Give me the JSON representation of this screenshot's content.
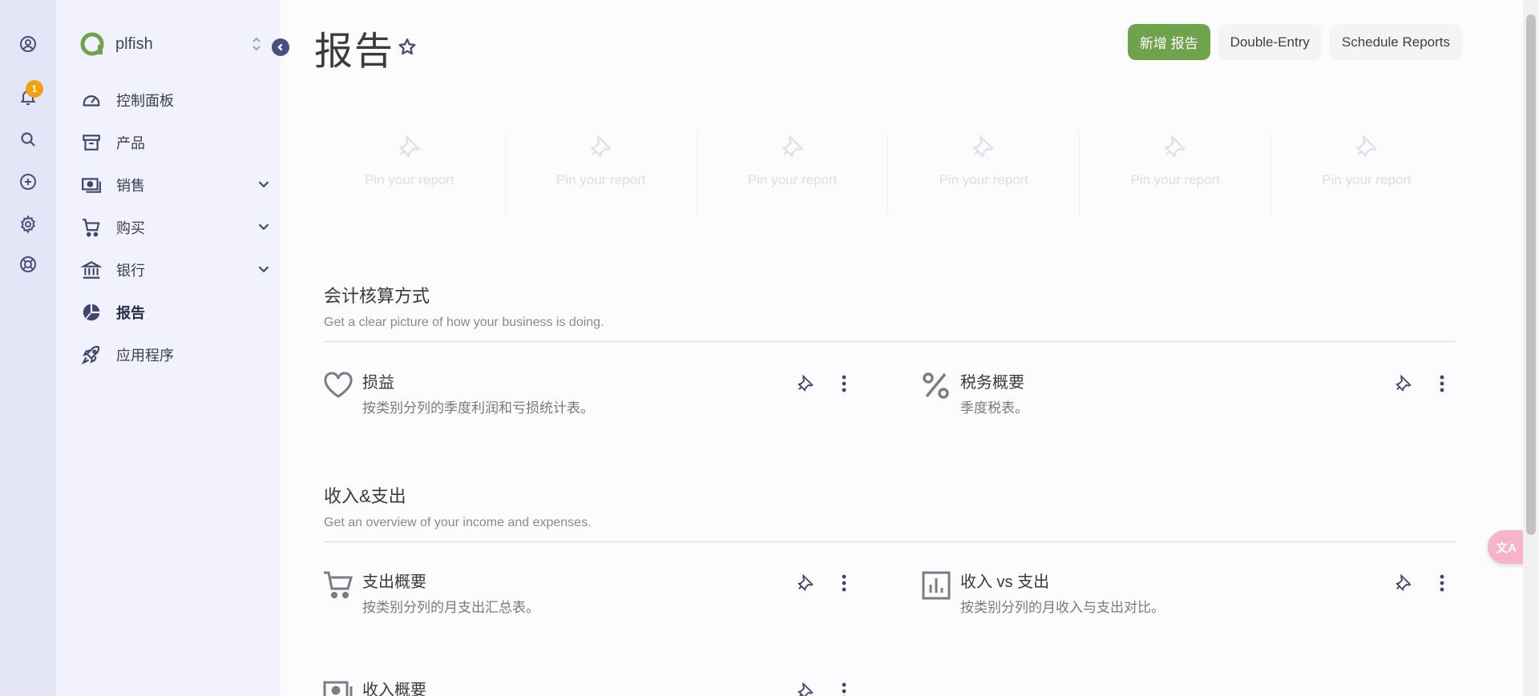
{
  "rail": {
    "notification_count": "1"
  },
  "sidebar": {
    "company_name": "plfish",
    "items": [
      {
        "label": "控制面板",
        "icon": "dashboard-icon"
      },
      {
        "label": "产品",
        "icon": "archive-icon"
      },
      {
        "label": "销售",
        "icon": "cash-icon"
      },
      {
        "label": "购买",
        "icon": "cart-icon"
      },
      {
        "label": "银行",
        "icon": "bank-icon"
      },
      {
        "label": "报告",
        "icon": "pie-chart-icon",
        "active": true
      },
      {
        "label": "应用程序",
        "icon": "rocket-icon"
      }
    ]
  },
  "header": {
    "title": "报告",
    "actions": {
      "new_report": "新增 报告",
      "double_entry": "Double-Entry",
      "schedule": "Schedule Reports"
    }
  },
  "pinned": {
    "placeholder": "Pin your report"
  },
  "sections": [
    {
      "title": "会计核算方式",
      "description": "Get a clear picture of how your business is doing.",
      "reports": [
        {
          "title": "损益",
          "description": "按类别分列的季度利润和亏损统计表。",
          "icon": "heart-icon"
        },
        {
          "title": "税务概要",
          "description": "季度税表。",
          "icon": "percent-icon"
        }
      ]
    },
    {
      "title": "收入&支出",
      "description": "Get an overview of your income and expenses.",
      "reports": [
        {
          "title": "支出概要",
          "description": "按类别分列的月支出汇总表。",
          "icon": "cart-icon"
        },
        {
          "title": "收入 vs 支出",
          "description": "按类别分列的月收入与支出对比。",
          "icon": "bar-chart-icon"
        },
        {
          "title": "收入概要",
          "description": "",
          "icon": "cash-icon"
        }
      ]
    }
  ],
  "translate_fab": "文A",
  "colors": {
    "primary": "#6ea24b",
    "rail": "#e4e6f8",
    "sidebar": "#f1f2fd",
    "badge": "#f2a20f"
  }
}
